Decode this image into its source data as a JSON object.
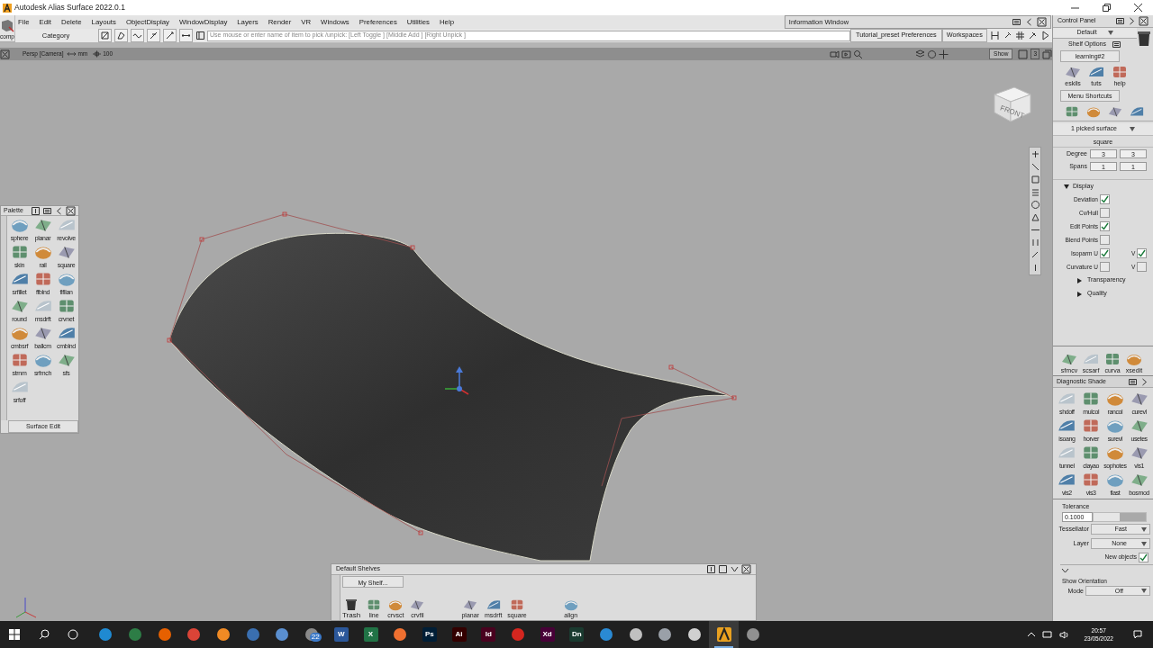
{
  "window": {
    "title": "Autodesk Alias Surface 2022.0.1"
  },
  "menu": [
    "File",
    "Edit",
    "Delete",
    "Layouts",
    "ObjectDisplay",
    "WindowDisplay",
    "Layers",
    "Render",
    "VR",
    "Windows",
    "Preferences",
    "Utilities",
    "Help"
  ],
  "comp_label": "comp",
  "toolbar": {
    "category": "Category",
    "prompt": "Use mouse or enter name of item to pick /unpick: [Left Toggle ] [Middle Add ] [Right Unpick ]",
    "preferences": "Tutorial_preset Preferences",
    "workspaces": "Workspaces"
  },
  "info_window": {
    "title": "Information Window"
  },
  "viewport": {
    "camera": "Persp [Camera]",
    "units": "mm",
    "grid": "100",
    "show": "Show",
    "layout_number": "3",
    "view_cube_face": "FRONT"
  },
  "palette": {
    "title": "Palette",
    "tools": [
      "sphere",
      "planar",
      "revolve",
      "skin",
      "rail",
      "square",
      "srfillet",
      "ffblnd",
      "flfllan",
      "round",
      "msdrft",
      "crvnet",
      "cmbsrf",
      "ballcm",
      "cmblnd",
      "strnm",
      "srfmch",
      "sfs",
      "srfoff"
    ],
    "tab": "Surface Edit"
  },
  "shelf": {
    "title": "Default Shelves",
    "tab": "My Shelf...",
    "tool_groups": [
      [
        {
          "label": "Trash",
          "kind": "trash"
        },
        {
          "label": "line",
          "kind": "tool"
        },
        {
          "label": "crvsct",
          "kind": "tool"
        },
        {
          "label": "crvfil",
          "kind": "tool"
        }
      ],
      [
        {
          "label": "planar",
          "kind": "tool"
        },
        {
          "label": "msdrft",
          "kind": "tool"
        },
        {
          "label": "square",
          "kind": "tool"
        }
      ],
      [
        {
          "label": "align",
          "kind": "tool"
        }
      ]
    ]
  },
  "control_panel": {
    "title": "Control Panel",
    "layout": "Default",
    "shelf_options": "Shelf Options",
    "tab": "learning#2",
    "shelf_tools": [
      "eskils",
      "tuts",
      "help"
    ],
    "menu_shortcuts": "Menu Shortcuts",
    "picked": "1 picked surface",
    "object_name": "square",
    "params": [
      {
        "label": "Degree",
        "u": "3",
        "v": "3"
      },
      {
        "label": "Spans",
        "u": "1",
        "v": "1"
      }
    ],
    "display": {
      "label": "Display",
      "expanded": true,
      "options": [
        {
          "label": "Deviation",
          "checked": true
        },
        {
          "label": "Cv/Hull",
          "checked": false
        },
        {
          "label": "Edit Points",
          "checked": true
        },
        {
          "label": "Blend Points",
          "checked": false
        },
        {
          "label": "Isoparm U",
          "checked": true,
          "v": {
            "label": "V",
            "checked": true
          }
        },
        {
          "label": "Curvature U",
          "checked": false,
          "v": {
            "label": "V",
            "checked": false
          }
        }
      ],
      "sections": [
        {
          "label": "Transparency",
          "expanded": false
        },
        {
          "label": "Quality",
          "expanded": false
        }
      ]
    },
    "curve_tools": [
      "sfmcv",
      "scsarf",
      "curva",
      "xsedit"
    ],
    "diagnostic": {
      "title": "Diagnostic Shade",
      "tools": [
        "shdoff",
        "mulcol",
        "rancol",
        "curevl",
        "isoang",
        "horver",
        "surevl",
        "usetes",
        "tunnel",
        "clayao",
        "sophotes",
        "vis1",
        "vis2",
        "vis3",
        "flast",
        "bosmod"
      ]
    },
    "tolerance": {
      "label": "Tolerance",
      "value": "0.1000",
      "level": 0.5
    },
    "tessellator": {
      "label": "Tessellator",
      "value": "Fast"
    },
    "layer": {
      "label": "Layer",
      "value": "None"
    },
    "new_objects": {
      "label": "New objects",
      "checked": true
    },
    "show_orientation": {
      "label": "Show Orientation",
      "mode_label": "Mode",
      "mode": "Off"
    }
  },
  "taskbar": {
    "mail_badge": "22",
    "apps": [
      {
        "kind": "tile",
        "color": "#1f8ad2",
        "selected": false
      },
      {
        "kind": "tile",
        "color": "#2d7d46",
        "selected": false
      },
      {
        "kind": "tile",
        "color": "#e66000",
        "selected": false
      },
      {
        "kind": "tile",
        "color": "#db4437",
        "selected": false
      },
      {
        "kind": "tile",
        "color": "#f08a24",
        "selected": false
      },
      {
        "kind": "tile",
        "color": "#3a6fb0",
        "selected": false
      },
      {
        "kind": "tile",
        "color": "#5a8fd0",
        "selected": false
      },
      {
        "kind": "tile",
        "color": "#8a8a8a",
        "selected": false
      },
      {
        "kind": "letter",
        "label": "W",
        "color": "#2b579a",
        "selected": false
      },
      {
        "kind": "letter",
        "label": "X",
        "color": "#217346",
        "selected": false
      },
      {
        "kind": "tile",
        "color": "#f07030",
        "selected": false
      },
      {
        "kind": "letter",
        "label": "Ps",
        "color": "#001e36",
        "selected": false
      },
      {
        "kind": "letter",
        "label": "Ai",
        "color": "#330000",
        "selected": false
      },
      {
        "kind": "letter",
        "label": "Id",
        "color": "#49021f",
        "selected": false
      },
      {
        "kind": "tile",
        "color": "#d4261f",
        "selected": false
      },
      {
        "kind": "letter",
        "label": "Xd",
        "color": "#470137",
        "selected": false
      },
      {
        "kind": "letter",
        "label": "Dn",
        "color": "#1a3a2f",
        "selected": false
      },
      {
        "kind": "tile",
        "color": "#2a8ad4",
        "selected": false
      },
      {
        "kind": "tile",
        "color": "#c0c0c0",
        "selected": false
      },
      {
        "kind": "tile",
        "color": "#9aa0a8",
        "selected": false
      },
      {
        "kind": "tile",
        "color": "#d0d0d0",
        "selected": false
      },
      {
        "kind": "alias",
        "color": "#e8a020",
        "selected": true
      },
      {
        "kind": "tile",
        "color": "#909090",
        "selected": false
      }
    ],
    "time": "20:57",
    "date": "23/05/2022"
  }
}
